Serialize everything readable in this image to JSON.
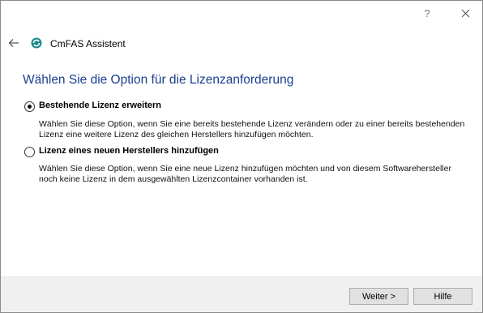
{
  "window": {
    "help_glyph": "?",
    "close_glyph": "✕"
  },
  "header": {
    "app_title": "CmFAS Assistent"
  },
  "page": {
    "title": "Wählen Sie die Option für die Lizenzanforderung"
  },
  "options": [
    {
      "label": "Bestehende Lizenz erweitern",
      "selected": true,
      "description_line1": "Wählen Sie diese Option, wenn Sie eine bereits bestehende Lizenz verändern oder zu einer bereits bestehenden",
      "description_line2": "Lizenz eine weitere Lizenz des gleichen Herstellers hinzufügen möchten."
    },
    {
      "label": "Lizenz eines neuen Herstellers hinzufügen",
      "selected": false,
      "description_line1": "Wählen Sie diese Option, wenn Sie eine neue Lizenz hinzufügen möchten und von diesem Softwarehersteller",
      "description_line2": "noch keine Lizenz in dem ausgewählten Lizenzcontainer vorhanden ist."
    }
  ],
  "footer": {
    "next_label": "Weiter >",
    "help_label": "Hilfe"
  },
  "colors": {
    "title_blue": "#1a3f8f",
    "logo_teal": "#1a8a8a",
    "footer_bg": "#f0f0f0"
  }
}
